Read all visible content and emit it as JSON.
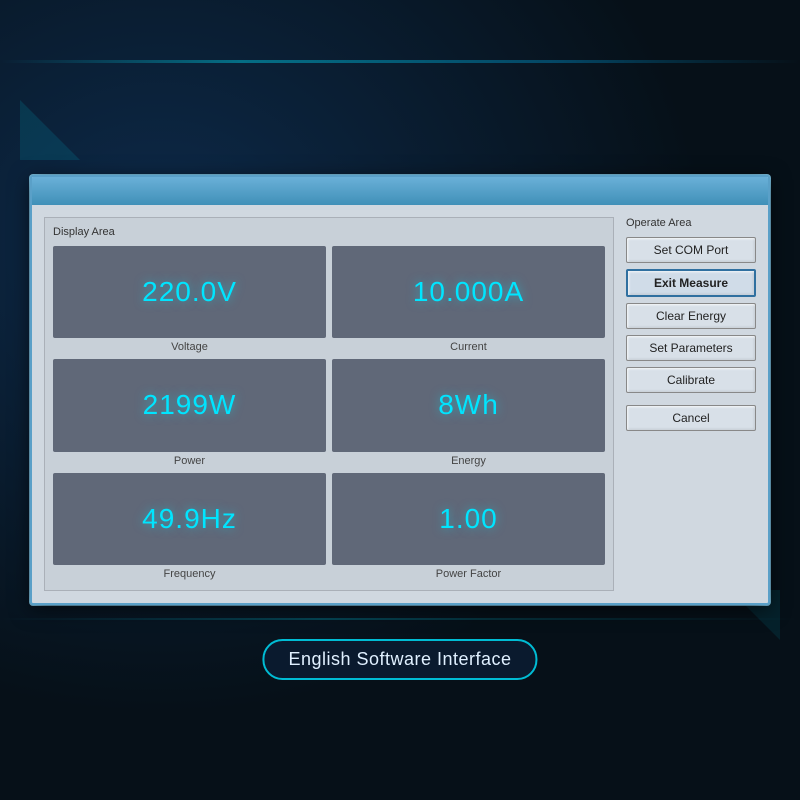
{
  "background": {
    "color": "#061018"
  },
  "dialog": {
    "display_section_label": "Display Area",
    "operate_section_label": "Operate Area",
    "metrics": [
      {
        "id": "voltage",
        "value": "220.0V",
        "label": "Voltage"
      },
      {
        "id": "current",
        "value": "10.000A",
        "label": "Current"
      },
      {
        "id": "power",
        "value": "2199W",
        "label": "Power"
      },
      {
        "id": "energy",
        "value": "8Wh",
        "label": "Energy"
      },
      {
        "id": "frequency",
        "value": "49.9Hz",
        "label": "Frequency"
      },
      {
        "id": "power-factor",
        "value": "1.00",
        "label": "Power Factor"
      }
    ],
    "buttons": [
      {
        "id": "set-com-port",
        "label": "Set COM Port",
        "active": false
      },
      {
        "id": "exit-measure",
        "label": "Exit Measure",
        "active": true
      },
      {
        "id": "clear-energy",
        "label": "Clear Energy",
        "active": false
      },
      {
        "id": "set-parameters",
        "label": "Set Parameters",
        "active": false
      },
      {
        "id": "calibrate",
        "label": "Calibrate",
        "active": false
      },
      {
        "id": "cancel",
        "label": "Cancel",
        "active": false
      }
    ]
  },
  "bottom_caption": {
    "text": "English Software Interface"
  }
}
